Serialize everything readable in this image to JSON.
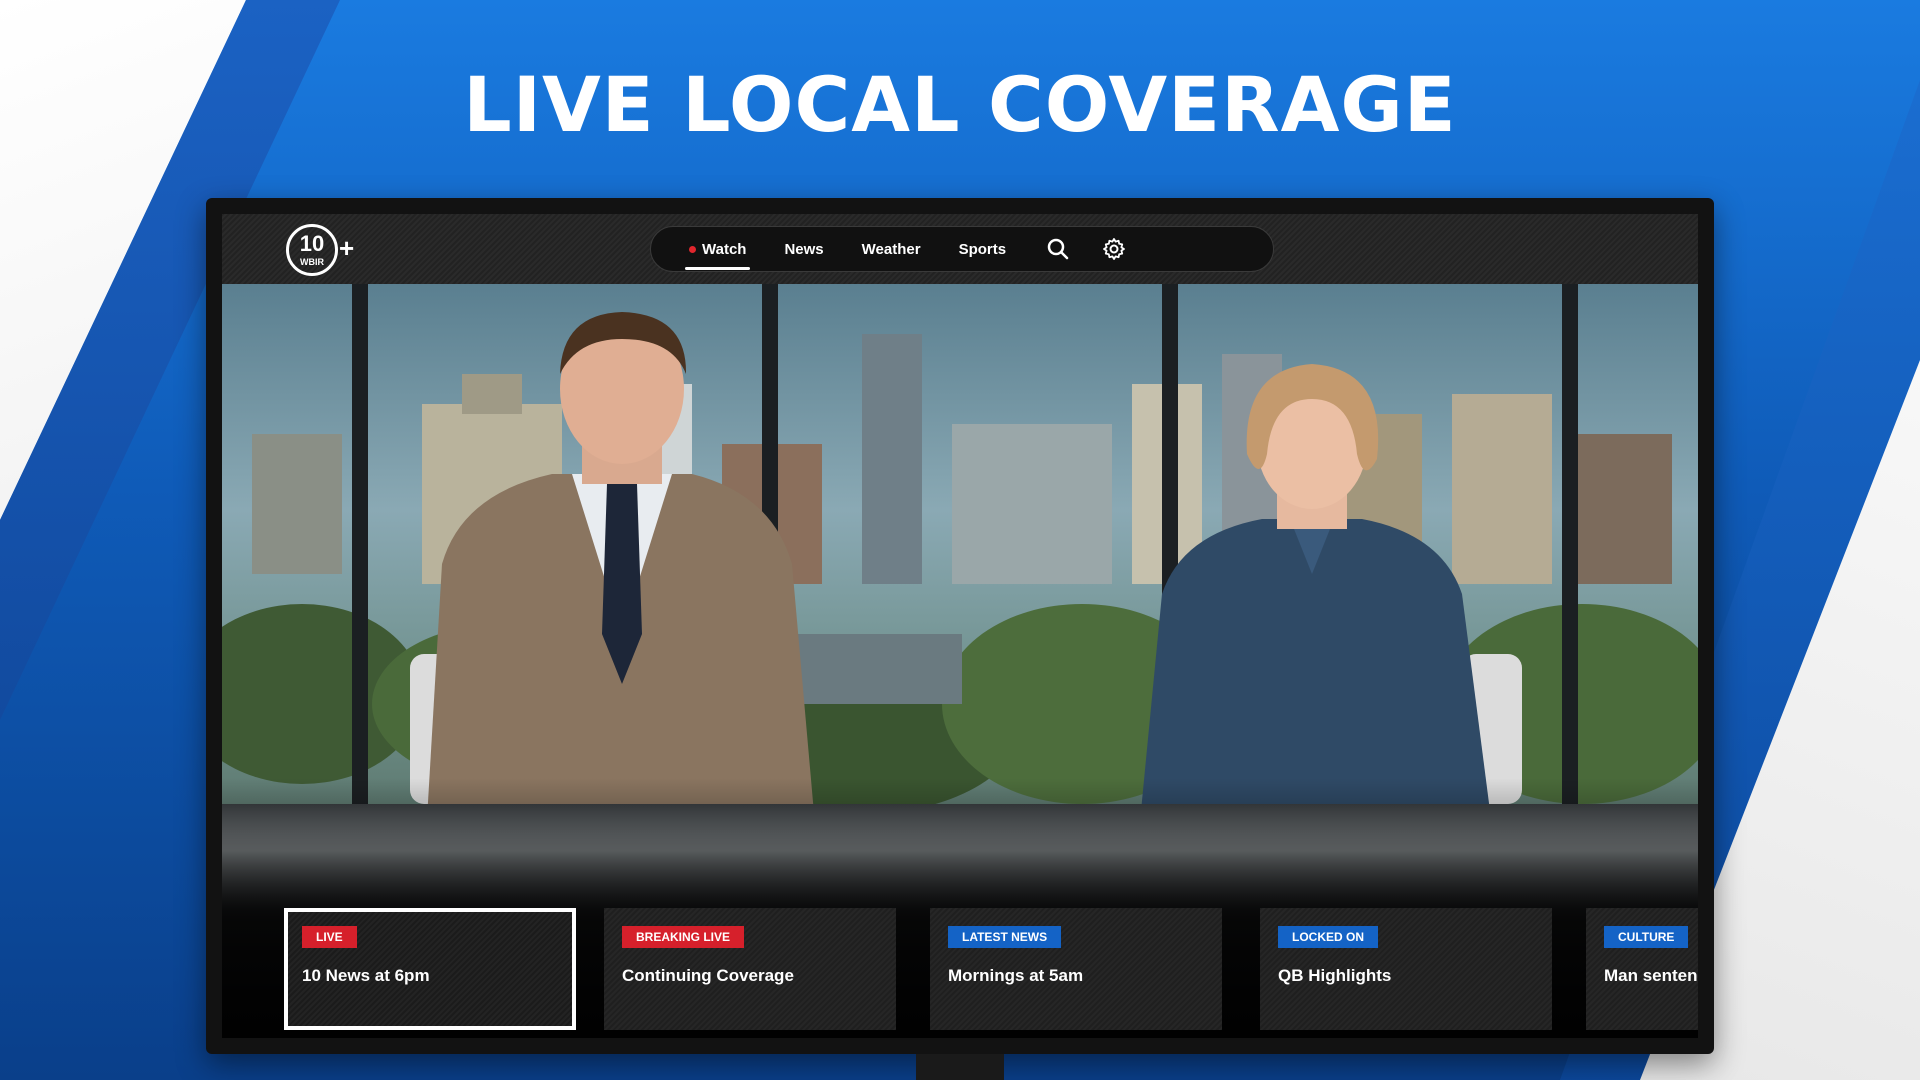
{
  "headline": "LIVE LOCAL COVERAGE",
  "logo": {
    "number": "10",
    "callsign": "WBIR",
    "plus": "+"
  },
  "nav": {
    "items": [
      {
        "label": "Watch",
        "active": true,
        "live": true
      },
      {
        "label": "News",
        "active": false
      },
      {
        "label": "Weather",
        "active": false
      },
      {
        "label": "Sports",
        "active": false
      }
    ],
    "icons": [
      "search-icon",
      "gear-icon"
    ]
  },
  "cards": [
    {
      "badge": "LIVE",
      "badge_color": "#d6202b",
      "title": "10 News at 6pm",
      "selected": true
    },
    {
      "badge": "BREAKING LIVE",
      "badge_color": "#d6202b",
      "title": "Continuing Coverage",
      "selected": false
    },
    {
      "badge": "LATEST NEWS",
      "badge_color": "#1463c6",
      "title": "Mornings at 5am",
      "selected": false
    },
    {
      "badge": "LOCKED ON",
      "badge_color": "#1463c6",
      "title": "QB Highlights",
      "selected": false
    },
    {
      "badge": "CULTURE",
      "badge_color": "#1463c6",
      "title": "Man sentenced",
      "selected": false
    }
  ],
  "colors": {
    "accent_blue": "#1463c6",
    "live_red": "#d6202b"
  }
}
